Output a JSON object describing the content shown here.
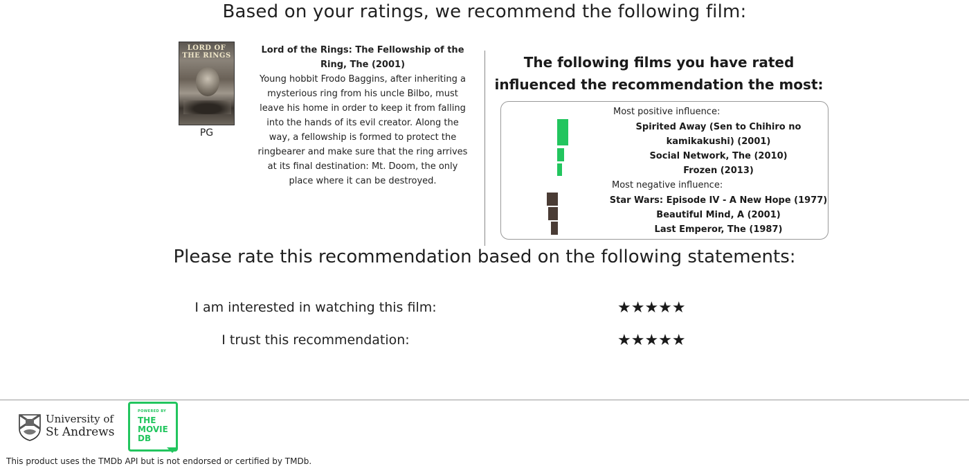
{
  "header": {
    "title": "Based on your ratings, we recommend the following film:"
  },
  "recommendation": {
    "poster_title": "LORD OF THE RINGS",
    "rating": "PG",
    "title": "Lord of the Rings: The Fellowship of the Ring, The (2001)",
    "description": "Young hobbit Frodo Baggins, after inheriting a mysterious ring from his uncle Bilbo, must leave his home in order to keep it from falling into the hands of its evil creator. Along the way, a fellowship is formed to protect the ringbearer and make sure that the ring arrives at its final destination: Mt. Doom, the only place where it can be destroyed."
  },
  "influence": {
    "heading": "The following films you have rated influenced the recommendation the most:",
    "positive_label": "Most positive influence:",
    "negative_label": "Most negative influence:",
    "positive": [
      {
        "title": "Spirited Away (Sen to Chihiro no kamikakushi) (2001)",
        "strength": 1.0
      },
      {
        "title": "Social Network, The (2010)",
        "strength": 0.64
      },
      {
        "title": "Frozen (2013)",
        "strength": 0.45
      }
    ],
    "negative": [
      {
        "title": "Star Wars: Episode IV - A New Hope (1977)",
        "strength": 1.0
      },
      {
        "title": "Beautiful Mind, A (2001)",
        "strength": 0.88
      },
      {
        "title": "Last Emperor, The (1987)",
        "strength": 0.65
      }
    ],
    "colors": {
      "positive": "#22c55e",
      "negative": "#4a3c35"
    }
  },
  "rating_section": {
    "heading": "Please rate this recommendation based on the following statements:",
    "statements": [
      {
        "text": "I am interested in watching this film:",
        "stars": "★★★★★"
      },
      {
        "text": "I trust this recommendation:",
        "stars": "★★★★★"
      }
    ]
  },
  "footer": {
    "university_line1": "University of",
    "university_line2": "St Andrews",
    "tmdb_powered": "POWERED BY",
    "tmdb_name": "THE MOVIE DB",
    "disclaimer": "This product uses the TMDb API but is not endorsed or certified by TMDb."
  }
}
